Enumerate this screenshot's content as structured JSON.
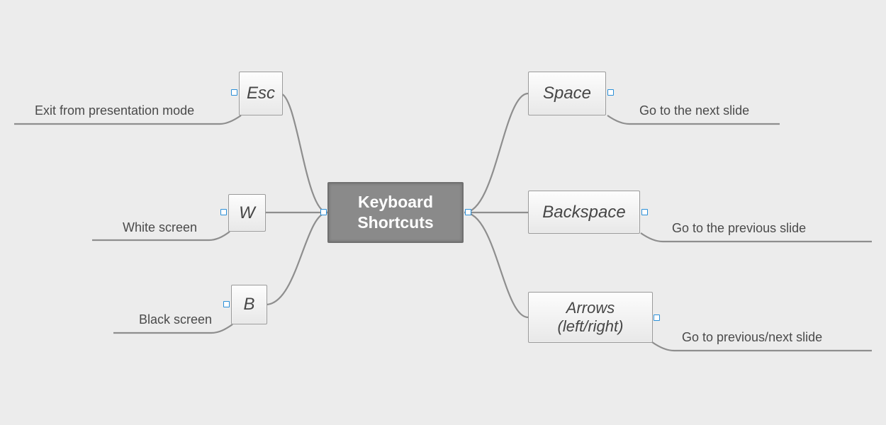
{
  "central": {
    "title": "Keyboard Shortcuts"
  },
  "left": [
    {
      "key": "Esc",
      "desc": "Exit from presentation mode"
    },
    {
      "key": "W",
      "desc": "White screen"
    },
    {
      "key": "B",
      "desc": "Black screen"
    }
  ],
  "right": [
    {
      "key": "Space",
      "desc": "Go to the next slide"
    },
    {
      "key": "Backspace",
      "desc": "Go to the previous slide"
    },
    {
      "key": "Arrows (left/right)",
      "desc": "Go to previous/next slide"
    }
  ]
}
